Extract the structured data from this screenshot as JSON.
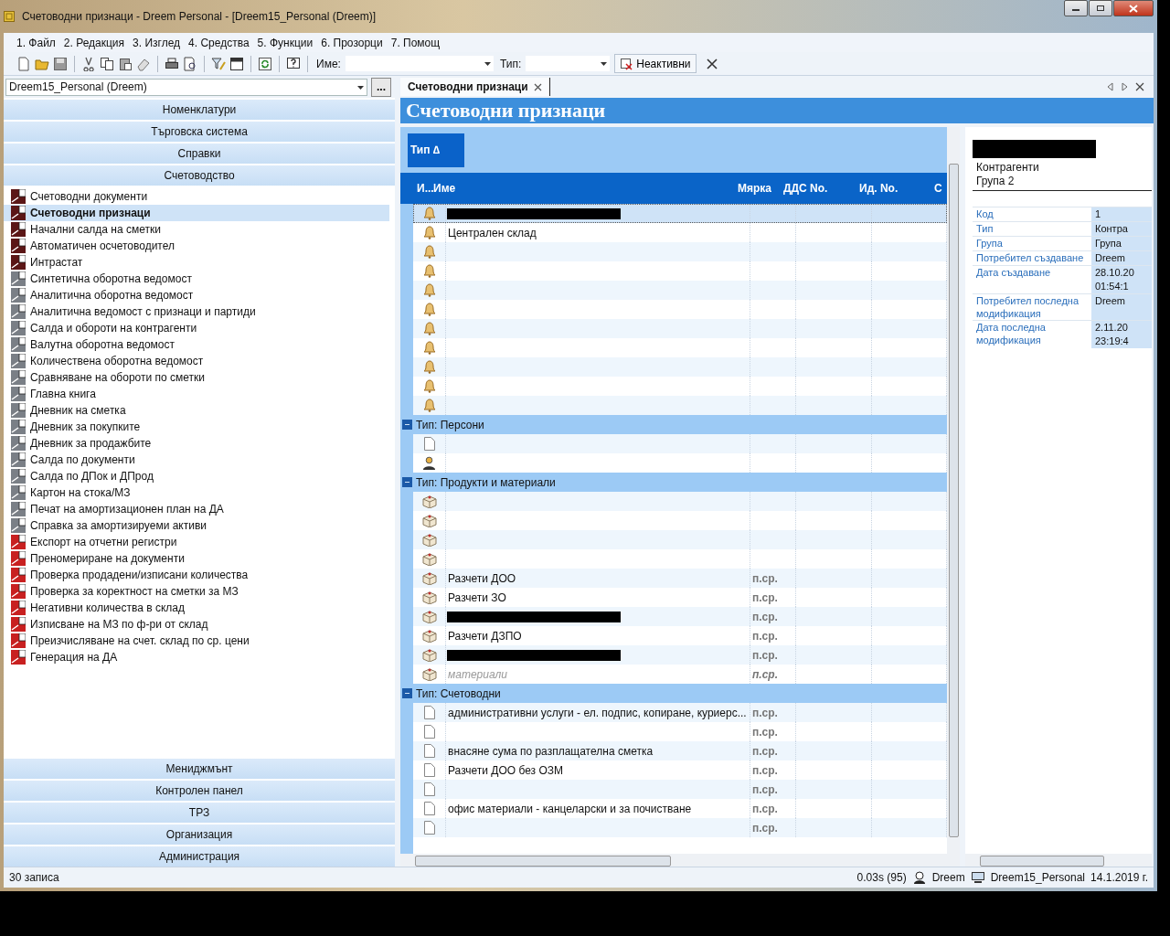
{
  "window": {
    "title": "Счетоводни признаци - Dreem Personal - [Dreem15_Personal (Dreem)]"
  },
  "menu": [
    "1. Файл",
    "2. Редакция",
    "3. Изглед",
    "4. Средства",
    "5. Функции",
    "6. Прозорци",
    "7. Помощ"
  ],
  "toolbar": {
    "name_label": "Име:",
    "type_label": "Тип:",
    "inactive_button": "Неактивни"
  },
  "sidebar": {
    "database": "Dreem15_Personal (Dreem)",
    "browse_button": "...",
    "sections": [
      {
        "label": "Номенклатури"
      },
      {
        "label": "Търговска система"
      },
      {
        "label": "Справки"
      },
      {
        "label": "Счетоводство",
        "items": [
          {
            "label": "Счетоводни документи",
            "kind": "list",
            "selected": false
          },
          {
            "label": "Счетоводни признаци",
            "kind": "list",
            "selected": true
          },
          {
            "label": "Начални салда на сметки",
            "kind": "list",
            "selected": false
          },
          {
            "label": "Автоматичен осчетоводител",
            "kind": "list",
            "selected": false
          },
          {
            "label": "Интрастат",
            "kind": "list",
            "selected": false
          },
          {
            "label": "Синтетична оборотна ведомост",
            "kind": "report",
            "selected": false
          },
          {
            "label": "Аналитична оборотна ведомост",
            "kind": "report",
            "selected": false
          },
          {
            "label": "Аналитична ведомост с признаци и партиди",
            "kind": "report",
            "selected": false
          },
          {
            "label": "Салда и обороти на контрагенти",
            "kind": "report",
            "selected": false
          },
          {
            "label": "Валутна оборотна ведомост",
            "kind": "report",
            "selected": false
          },
          {
            "label": "Количествена оборотна ведомост",
            "kind": "report",
            "selected": false
          },
          {
            "label": "Сравняване на обороти по сметки",
            "kind": "report",
            "selected": false
          },
          {
            "label": "Главна книга",
            "kind": "report",
            "selected": false
          },
          {
            "label": "Дневник на сметка",
            "kind": "report",
            "selected": false
          },
          {
            "label": "Дневник за покупките",
            "kind": "report",
            "selected": false
          },
          {
            "label": "Дневник за продажбите",
            "kind": "report",
            "selected": false
          },
          {
            "label": "Салда по документи",
            "kind": "report",
            "selected": false
          },
          {
            "label": "Салда по ДПок и ДПрод",
            "kind": "report",
            "selected": false
          },
          {
            "label": "Картон на стока/МЗ",
            "kind": "report",
            "selected": false
          },
          {
            "label": "Печат на амортизационен план на ДА",
            "kind": "report",
            "selected": false
          },
          {
            "label": "Справка за амортизируеми активи",
            "kind": "report",
            "selected": false
          },
          {
            "label": "Експорт на отчетни регистри",
            "kind": "function",
            "selected": false
          },
          {
            "label": "Преномериране на документи",
            "kind": "function",
            "selected": false
          },
          {
            "label": "Проверка продадени/изписани количества",
            "kind": "function",
            "selected": false
          },
          {
            "label": "Проверка за коректност на сметки за МЗ",
            "kind": "function",
            "selected": false
          },
          {
            "label": "Негативни количества в склад",
            "kind": "function",
            "selected": false
          },
          {
            "label": "Изписване на МЗ по ф-ри от склад",
            "kind": "function",
            "selected": false
          },
          {
            "label": "Преизчисляване на счет. склад по ср. цени",
            "kind": "function",
            "selected": false
          },
          {
            "label": "Генерация на ДА",
            "kind": "function",
            "selected": false
          }
        ]
      },
      {
        "label": "Мениджмънт"
      },
      {
        "label": "Контролен панел"
      },
      {
        "label": "ТРЗ"
      },
      {
        "label": "Организация"
      },
      {
        "label": "Администрация"
      }
    ]
  },
  "tabs": [
    {
      "label": "Счетоводни признаци",
      "selected": true
    }
  ],
  "document_title": "Счетоводни признаци",
  "grid": {
    "group_by": "Тип ∆",
    "columns": [
      "И...",
      "Име",
      "Мярка",
      "ДДС No.",
      "Ид. No.",
      "С"
    ],
    "groups": [
      {
        "rows": [
          {
            "kind": "bell",
            "redacted": true,
            "selected": true
          },
          {
            "kind": "bell",
            "name": "Централен склад",
            "redacted": false,
            "selected": false,
            "inactive": false
          },
          {
            "kind": "bell",
            "redacted": false,
            "selected": false
          },
          {
            "kind": "bell",
            "redacted": false,
            "selected": false
          },
          {
            "kind": "bell",
            "redacted": false,
            "selected": false
          },
          {
            "kind": "bell",
            "redacted": false,
            "selected": false
          },
          {
            "kind": "bell",
            "redacted": false,
            "selected": false
          },
          {
            "kind": "bell",
            "redacted": false,
            "selected": false
          },
          {
            "kind": "bell",
            "redacted": false,
            "selected": false
          },
          {
            "kind": "bell",
            "redacted": false,
            "selected": false
          },
          {
            "kind": "bell",
            "redacted": false,
            "selected": false
          }
        ]
      },
      {
        "label": "Тип: Персони",
        "expanded": true,
        "rows": [
          {
            "kind": "document",
            "redacted": false,
            "selected": false
          },
          {
            "kind": "person",
            "redacted": false,
            "selected": false
          }
        ]
      },
      {
        "label": "Тип: Продукти и материали",
        "expanded": true,
        "rows": [
          {
            "kind": "box",
            "redacted": false,
            "selected": false
          },
          {
            "kind": "box",
            "redacted": false,
            "selected": false
          },
          {
            "kind": "box",
            "redacted": false,
            "selected": false
          },
          {
            "kind": "box",
            "redacted": false,
            "selected": false
          },
          {
            "kind": "box",
            "name": "Разчети ДОО",
            "unit": "п.ср.",
            "redacted": false,
            "selected": false,
            "inactive": false
          },
          {
            "kind": "box",
            "name": "Разчети ЗО",
            "unit": "п.ср.",
            "redacted": false,
            "selected": false,
            "inactive": false
          },
          {
            "kind": "box",
            "unit": "п.ср.",
            "redacted": true,
            "selected": false
          },
          {
            "kind": "box",
            "name": "Разчети ДЗПО",
            "unit": "п.ср.",
            "redacted": false,
            "selected": false,
            "inactive": false
          },
          {
            "kind": "box",
            "unit": "п.ср.",
            "redacted": true,
            "selected": false
          },
          {
            "kind": "box",
            "name": "материали",
            "unit": "п.ср.",
            "redacted": false,
            "selected": false,
            "inactive": true
          }
        ]
      },
      {
        "label": "Тип: Счетоводни",
        "expanded": true,
        "rows": [
          {
            "kind": "document",
            "name": "административни услуги - ел. подпис, копиране, куриерс...",
            "unit": "п.ср.",
            "redacted": false,
            "selected": false,
            "inactive": false
          },
          {
            "kind": "document",
            "unit": "п.ср.",
            "redacted": false,
            "selected": false
          },
          {
            "kind": "document",
            "name": "внасяне сума по разплащателна сметка",
            "unit": "п.ср.",
            "redacted": false,
            "selected": false,
            "inactive": false
          },
          {
            "kind": "document",
            "name": "Разчети ДОО без ОЗМ",
            "unit": "п.ср.",
            "redacted": false,
            "selected": false,
            "inactive": false
          },
          {
            "kind": "document",
            "unit": "п.ср.",
            "redacted": false,
            "selected": false
          },
          {
            "kind": "document",
            "name": "офис материали - канцеларски и за почистване",
            "unit": "п.ср.",
            "redacted": false,
            "selected": false,
            "inactive": false
          },
          {
            "kind": "document",
            "unit": "п.ср.",
            "redacted": false,
            "selected": false
          }
        ]
      }
    ]
  },
  "details": {
    "title_redacted": true,
    "lines": [
      "Контрагенти",
      "Група 2"
    ],
    "properties": [
      {
        "label": "Код",
        "value": "1"
      },
      {
        "label": "Тип",
        "value": "Контра"
      },
      {
        "label": "Група",
        "value": "Група"
      },
      {
        "label": "Потребител създаване",
        "value": "Dreem"
      },
      {
        "label": "Дата създаване",
        "value": "28.10.20\n01:54:1"
      },
      {
        "label": "Потребител последна\nмодификация",
        "value": "Dreem"
      },
      {
        "label": "Дата последна\nмодификация",
        "value": "2.11.20\n23:19:4"
      }
    ]
  },
  "status_bar": {
    "records": "30 записа",
    "timing": "0.03s (95)",
    "user": "Dreem",
    "database": "Dreem15_Personal",
    "date": "14.1.2019 г."
  }
}
